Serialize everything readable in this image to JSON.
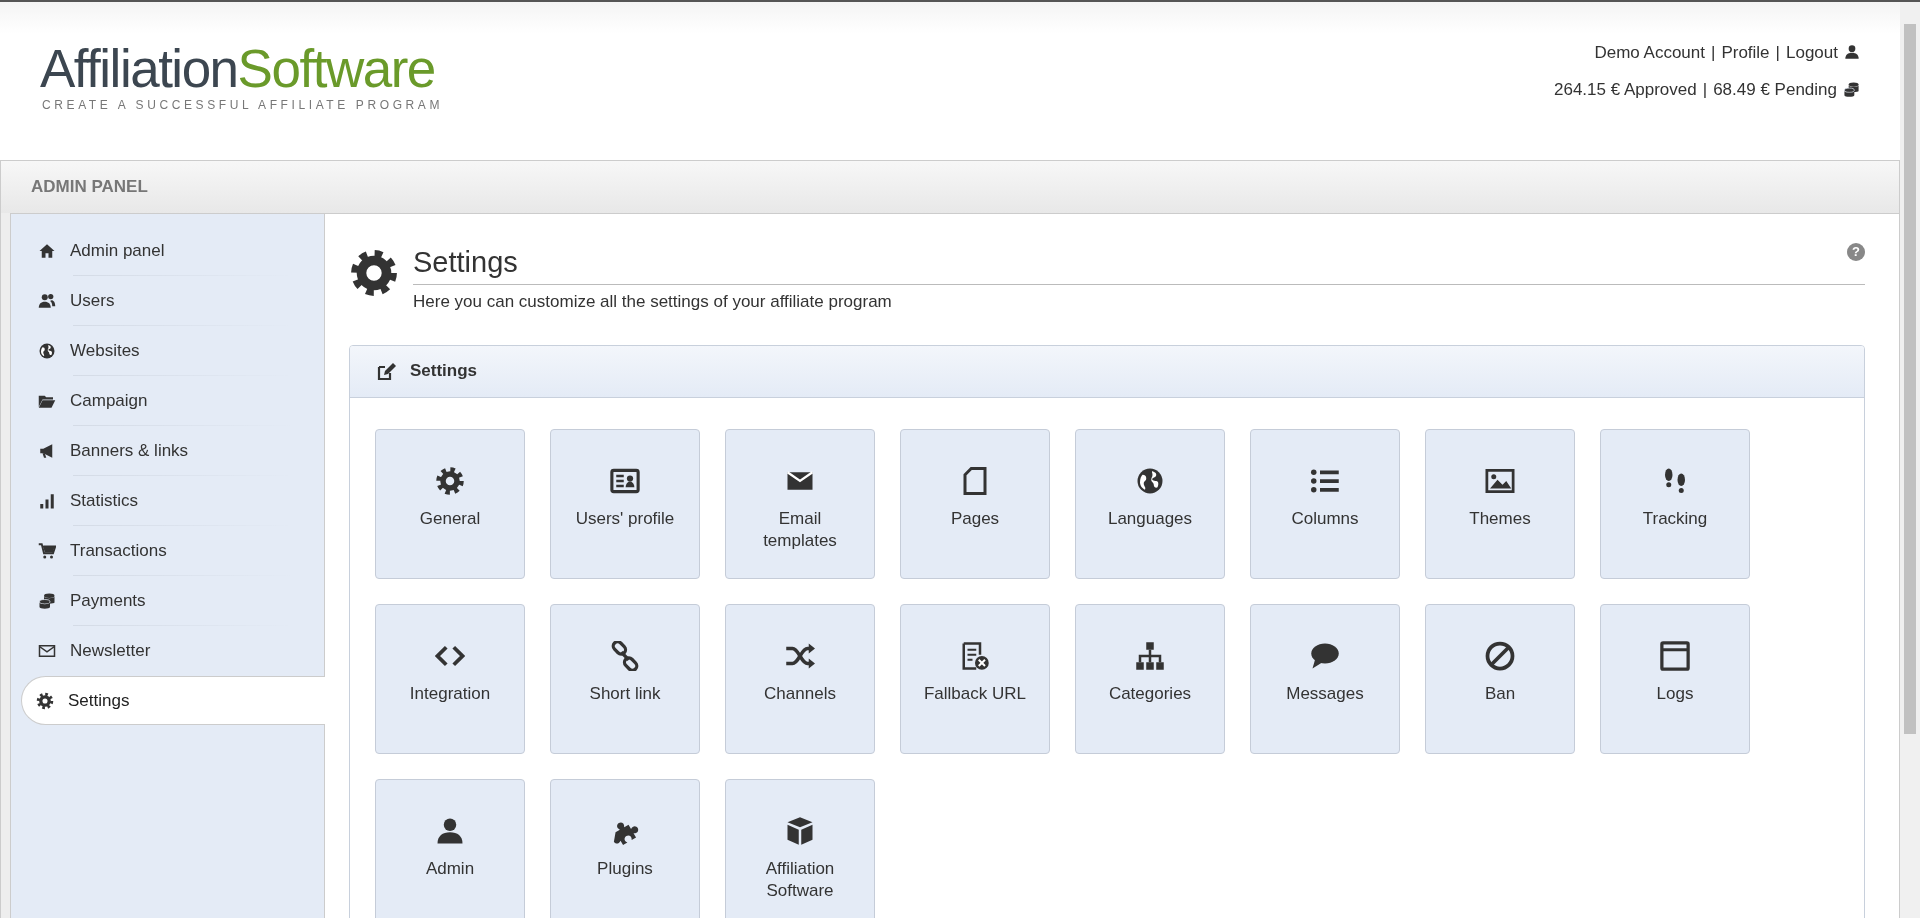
{
  "header": {
    "logo": {
      "part_1": "Affiliation",
      "part_2": "Software",
      "tagline": "CREATE A SUCCESSFUL AFFILIATE PROGRAM"
    },
    "account_links": [
      "Demo Account",
      "Profile",
      "Logout"
    ],
    "separator": "|",
    "balance": [
      "264.15 € Approved",
      "68.49 € Pending"
    ]
  },
  "panel_bar": {
    "title": "ADMIN PANEL"
  },
  "sidebar": {
    "items": [
      {
        "label": "Admin panel",
        "selected": false
      },
      {
        "label": "Users",
        "selected": false
      },
      {
        "label": "Websites",
        "selected": false
      },
      {
        "label": "Campaign",
        "selected": false
      },
      {
        "label": "Banners & links",
        "selected": false
      },
      {
        "label": "Statistics",
        "selected": false
      },
      {
        "label": "Transactions",
        "selected": false
      },
      {
        "label": "Payments",
        "selected": false
      },
      {
        "label": "Newsletter",
        "selected": false
      },
      {
        "label": "Settings",
        "selected": true
      }
    ]
  },
  "page": {
    "help": "?",
    "title": "Settings",
    "subtitle": "Here you can customize all the settings of your affiliate program"
  },
  "settings_panel": {
    "title": "Settings",
    "tiles": [
      {
        "label": "General"
      },
      {
        "label": "Users' profile"
      },
      {
        "label": "Email templates"
      },
      {
        "label": "Pages"
      },
      {
        "label": "Languages"
      },
      {
        "label": "Columns"
      },
      {
        "label": "Themes"
      },
      {
        "label": "Tracking"
      },
      {
        "label": "Integration"
      },
      {
        "label": "Short link"
      },
      {
        "label": "Channels"
      },
      {
        "label": "Fallback URL"
      },
      {
        "label": "Categories"
      },
      {
        "label": "Messages"
      },
      {
        "label": "Ban"
      },
      {
        "label": "Logs"
      },
      {
        "label": "Admin"
      },
      {
        "label": "Plugins"
      },
      {
        "label": "Affiliation Software"
      }
    ]
  }
}
